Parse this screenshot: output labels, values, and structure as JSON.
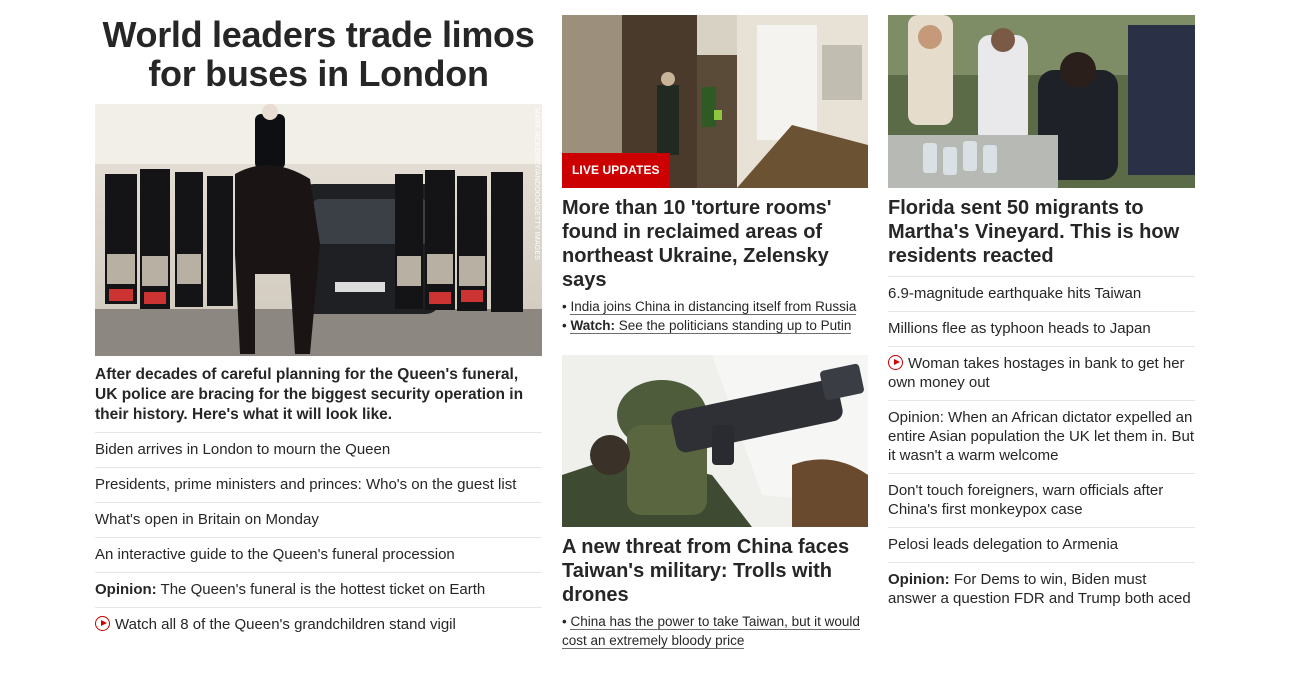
{
  "lead": {
    "headline": "World leaders trade limos for buses in London",
    "image_credit": "MARK MCKEWEY/ANDOGO/GETTY IMAGES",
    "summary": "After decades of careful planning for the Queen's funeral, UK police are bracing for the biggest security operation in their history. Here's what it will look like.",
    "links": [
      {
        "text": "Biden arrives in London to mourn the Queen"
      },
      {
        "text": "Presidents, prime ministers and princes: Who's on the guest list"
      },
      {
        "text": "What's open in Britain on Monday"
      },
      {
        "text": "An interactive guide to the Queen's funeral procession"
      },
      {
        "prefix": "Opinion:",
        "text": " The Queen's funeral is the hottest ticket on Earth"
      },
      {
        "video": true,
        "text": "Watch all 8 of the Queen's grandchildren stand vigil"
      }
    ]
  },
  "ukraine": {
    "badge": "LIVE UPDATES",
    "headline": "More than 10 'torture rooms' found in reclaimed areas of northeast Ukraine, Zelensky says",
    "bullets": [
      {
        "text": "India joins China in distancing itself from Russia"
      },
      {
        "prefix": "Watch:",
        "text": " See the politicians standing up to Putin"
      }
    ]
  },
  "taiwan": {
    "headline": "A new threat from China faces Taiwan's military: Trolls with drones",
    "bullets": [
      {
        "text": "China has the power to take Taiwan, but it would cost an extremely bloody price"
      }
    ]
  },
  "florida": {
    "headline": "Florida sent 50 migrants to Martha's Vineyard. This is how residents reacted",
    "links": [
      {
        "text": "6.9-magnitude earthquake hits Taiwan"
      },
      {
        "text": "Millions flee as typhoon heads to Japan"
      },
      {
        "video": true,
        "text": "Woman takes hostages in bank to get her own money out"
      },
      {
        "text": "Opinion: When an African dictator expelled an entire Asian population the UK let them in. But it wasn't a warm welcome"
      },
      {
        "text": "Don't touch foreigners, warn officials after China's first monkeypox case"
      },
      {
        "text": "Pelosi leads delegation to Armenia"
      },
      {
        "prefix": "Opinion:",
        "text": " For Dems to win, Biden must answer a question FDR and Trump both aced"
      }
    ]
  },
  "colors": {
    "accent": "#cc0000",
    "text": "#262626",
    "divider": "#e6e6e6"
  }
}
